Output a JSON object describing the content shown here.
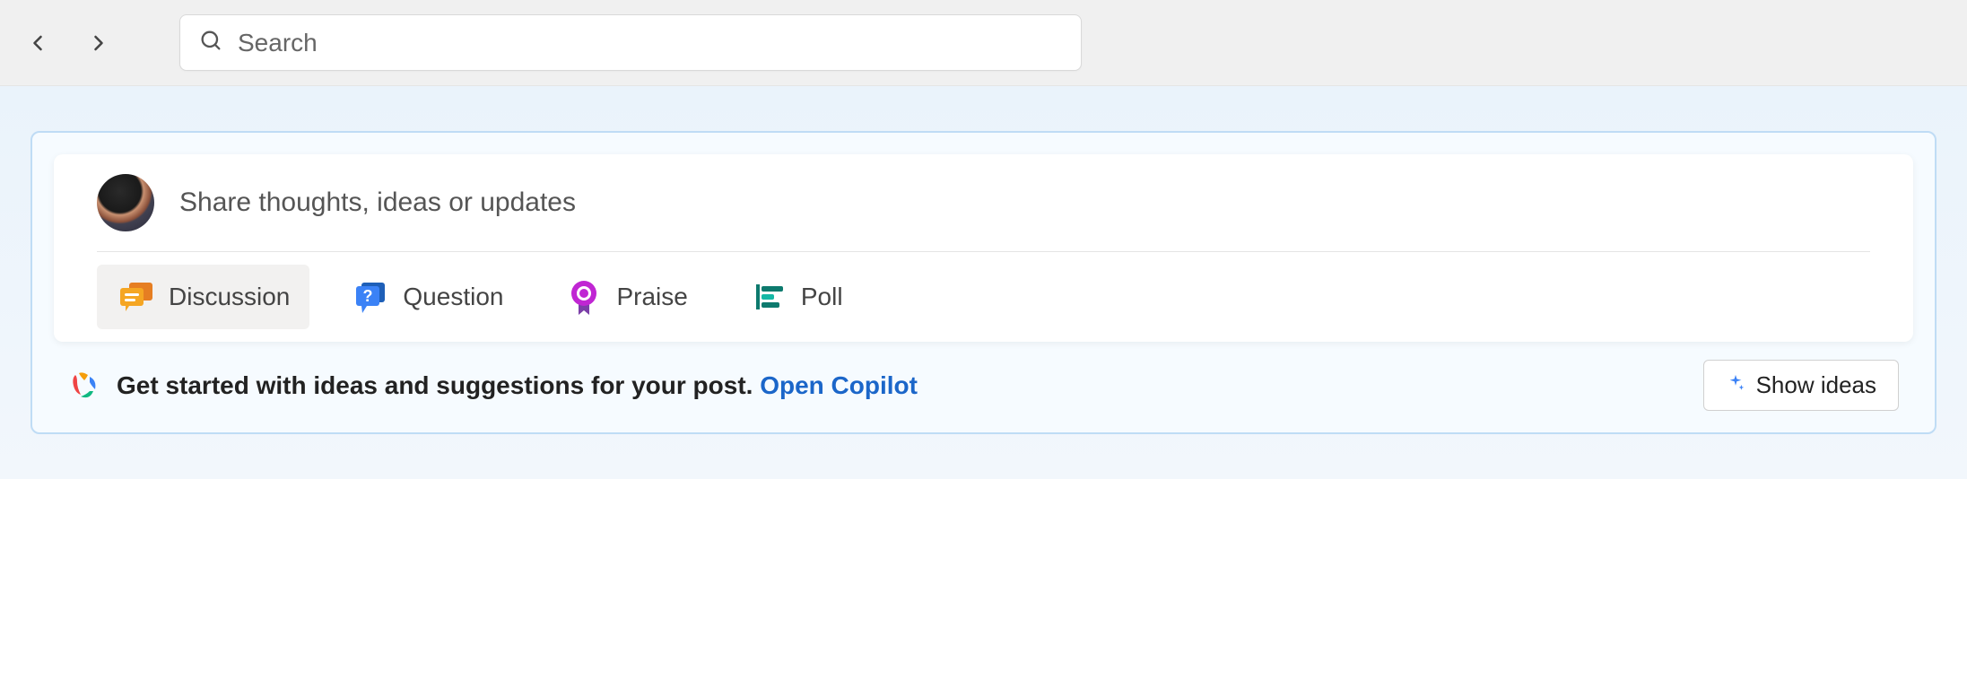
{
  "header": {
    "search_placeholder": "Search"
  },
  "composer": {
    "prompt": "Share thoughts, ideas or updates",
    "post_types": {
      "discussion": "Discussion",
      "question": "Question",
      "praise": "Praise",
      "poll": "Poll"
    }
  },
  "copilot": {
    "message": "Get started with ideas and suggestions for your post. ",
    "link": "Open Copilot",
    "button": "Show ideas"
  }
}
